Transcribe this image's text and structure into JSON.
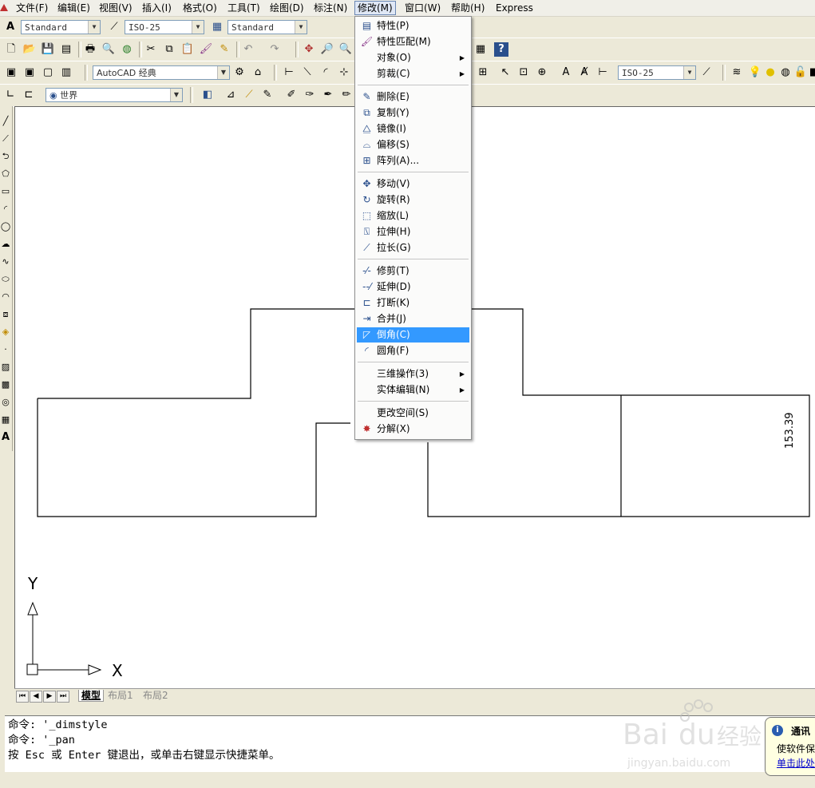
{
  "menubar": {
    "items": [
      "文件(F)",
      "编辑(E)",
      "视图(V)",
      "插入(I)",
      "格式(O)",
      "工具(T)",
      "绘图(D)",
      "标注(N)",
      "修改(M)",
      "窗口(W)",
      "帮助(H)",
      "Express"
    ]
  },
  "toolbar1": {
    "text_style": "Standard",
    "dim_style": "ISO-25",
    "table_style": "Standard"
  },
  "toolbar3": {
    "workspace": "AutoCAD 经典",
    "dim_style2": "ISO-25"
  },
  "toolbar4": {
    "ucs": "世界"
  },
  "modify_menu": {
    "items": [
      {
        "label": "特性(P)",
        "icon": "properties-icon",
        "submenu": false
      },
      {
        "label": "特性匹配(M)",
        "icon": "match-properties-icon",
        "submenu": false
      },
      {
        "label": "对象(O)",
        "icon": "",
        "submenu": true
      },
      {
        "label": "剪裁(C)",
        "icon": "",
        "submenu": true
      },
      {
        "label": "删除(E)",
        "icon": "erase-icon",
        "submenu": false
      },
      {
        "label": "复制(Y)",
        "icon": "copy-icon",
        "submenu": false
      },
      {
        "label": "镜像(I)",
        "icon": "mirror-icon",
        "submenu": false
      },
      {
        "label": "偏移(S)",
        "icon": "offset-icon",
        "submenu": false
      },
      {
        "label": "阵列(A)...",
        "icon": "array-icon",
        "submenu": false
      },
      {
        "label": "移动(V)",
        "icon": "move-icon",
        "submenu": false
      },
      {
        "label": "旋转(R)",
        "icon": "rotate-icon",
        "submenu": false
      },
      {
        "label": "缩放(L)",
        "icon": "scale-icon",
        "submenu": false
      },
      {
        "label": "拉伸(H)",
        "icon": "stretch-icon",
        "submenu": false
      },
      {
        "label": "拉长(G)",
        "icon": "lengthen-icon",
        "submenu": false
      },
      {
        "label": "修剪(T)",
        "icon": "trim-icon",
        "submenu": false
      },
      {
        "label": "延伸(D)",
        "icon": "extend-icon",
        "submenu": false
      },
      {
        "label": "打断(K)",
        "icon": "break-icon",
        "submenu": false
      },
      {
        "label": "合并(J)",
        "icon": "join-icon",
        "submenu": false
      },
      {
        "label": "倒角(C)",
        "icon": "chamfer-icon",
        "submenu": false,
        "highlighted": true
      },
      {
        "label": "圆角(F)",
        "icon": "fillet-icon",
        "submenu": false
      },
      {
        "label": "三维操作(3)",
        "icon": "",
        "submenu": true
      },
      {
        "label": "实体编辑(N)",
        "icon": "",
        "submenu": true
      },
      {
        "label": "更改空间(S)",
        "icon": "",
        "submenu": false
      },
      {
        "label": "分解(X)",
        "icon": "explode-icon",
        "submenu": false
      }
    ]
  },
  "drawing": {
    "dimension_text": "153.39",
    "ucs_x_label": "X",
    "ucs_y_label": "Y"
  },
  "layout_tabs": [
    "模型",
    "布局1",
    "布局2"
  ],
  "command_history": [
    "命令: '_dimstyle",
    "命令: '_pan",
    "按 Esc 或 Enter 键退出，或单击右键显示快捷菜单。"
  ],
  "notification": {
    "title": "通讯",
    "line1": "使软件保",
    "link": "单击此处"
  },
  "colors": {
    "highlight": "#3399ff",
    "toolbar_bg": "#ece9d8"
  }
}
